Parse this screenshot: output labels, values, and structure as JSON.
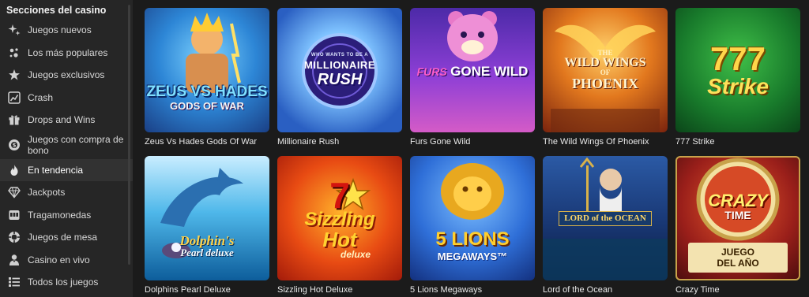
{
  "sidebar": {
    "title": "Secciones del casino",
    "items": [
      {
        "label": "Juegos nuevos",
        "icon": "sparkle-icon"
      },
      {
        "label": "Los más populares",
        "icon": "stars-icon"
      },
      {
        "label": "Juegos exclusivos",
        "icon": "star-person-icon"
      },
      {
        "label": "Crash",
        "icon": "chart-icon"
      },
      {
        "label": "Drops and Wins",
        "icon": "gift-icon"
      },
      {
        "label": "Juegos con compra de bono",
        "icon": "bonus-coin-icon"
      },
      {
        "label": "En tendencia",
        "icon": "flame-icon"
      },
      {
        "label": "Jackpots",
        "icon": "diamond-icon"
      },
      {
        "label": "Tragamonedas",
        "icon": "slot-machine-icon"
      },
      {
        "label": "Juegos de mesa",
        "icon": "poker-chip-icon"
      },
      {
        "label": "Casino en vivo",
        "icon": "dealer-icon"
      },
      {
        "label": "Todos los juegos",
        "icon": "list-icon"
      }
    ],
    "active_index": 6
  },
  "games": [
    {
      "title": "Zeus Vs Hades Gods Of War",
      "logo_line1": "ZEUS VS HADES",
      "logo_line2": "GODS OF WAR"
    },
    {
      "title": "Millionaire Rush",
      "logo_line0": "WHO WANTS TO BE A",
      "logo_line1": "MILLIONAIRE",
      "logo_line2": "RUSH"
    },
    {
      "title": "Furs Gone Wild",
      "logo_line1": "FURS",
      "logo_line2": "GONE WILD"
    },
    {
      "title": "The Wild Wings Of Phoenix",
      "logo_line0": "THE",
      "logo_line1": "WILD WINGS",
      "logo_line1b": "OF",
      "logo_line2": "PHOENIX"
    },
    {
      "title": "777 Strike",
      "logo_line1": "777",
      "logo_line2": "Strike"
    },
    {
      "title": "Dolphins Pearl Deluxe",
      "logo_line1": "Dolphin's",
      "logo_line2": "Pearl deluxe"
    },
    {
      "title": "Sizzling Hot Deluxe",
      "logo_line0": "7",
      "logo_line1": "Sizzling",
      "logo_line2": "Hot",
      "logo_line3": "deluxe"
    },
    {
      "title": "5 Lions Megaways",
      "logo_line1": "5 LIONS",
      "logo_line2": "MEGAWAYS™"
    },
    {
      "title": "Lord of the Ocean",
      "logo_line1": "LORD of the OCEAN"
    },
    {
      "title": "Crazy Time",
      "logo_line1": "CRAZY",
      "logo_line2": "TIME",
      "badge_line1": "JUEGO",
      "badge_line2": "DEL AÑO"
    }
  ],
  "colors": {
    "sidebar_bg": "#262626",
    "page_bg": "#1b1b1b",
    "active_bg": "#323232"
  }
}
